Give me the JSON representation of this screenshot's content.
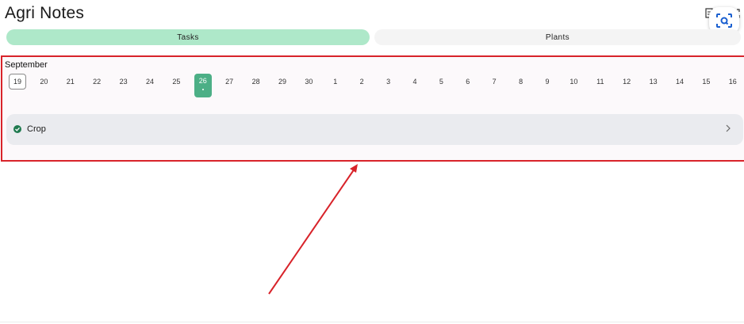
{
  "app": {
    "title": "Agri Notes"
  },
  "tabs": [
    {
      "label": "Tasks",
      "active": true
    },
    {
      "label": "Plants",
      "active": false
    }
  ],
  "calendar": {
    "month": "September",
    "days": [
      "19",
      "20",
      "21",
      "22",
      "23",
      "24",
      "25",
      "26",
      "27",
      "28",
      "29",
      "30",
      "1",
      "2",
      "3",
      "4",
      "5",
      "6",
      "7",
      "8",
      "9",
      "10",
      "11",
      "12",
      "13",
      "14",
      "15",
      "16"
    ],
    "today": "19",
    "selected": "26"
  },
  "tasks": [
    {
      "label": "Crop",
      "status": "completed",
      "icon": "check-circle-icon"
    }
  ],
  "icons": {
    "top_right": [
      "document-icon",
      "expand-icon",
      "scan-icon"
    ],
    "row_action": "chevron-right-icon"
  },
  "colors": {
    "accent": "#4caf86",
    "active_tab": "#aee8c9",
    "annotation": "#d8232a"
  }
}
